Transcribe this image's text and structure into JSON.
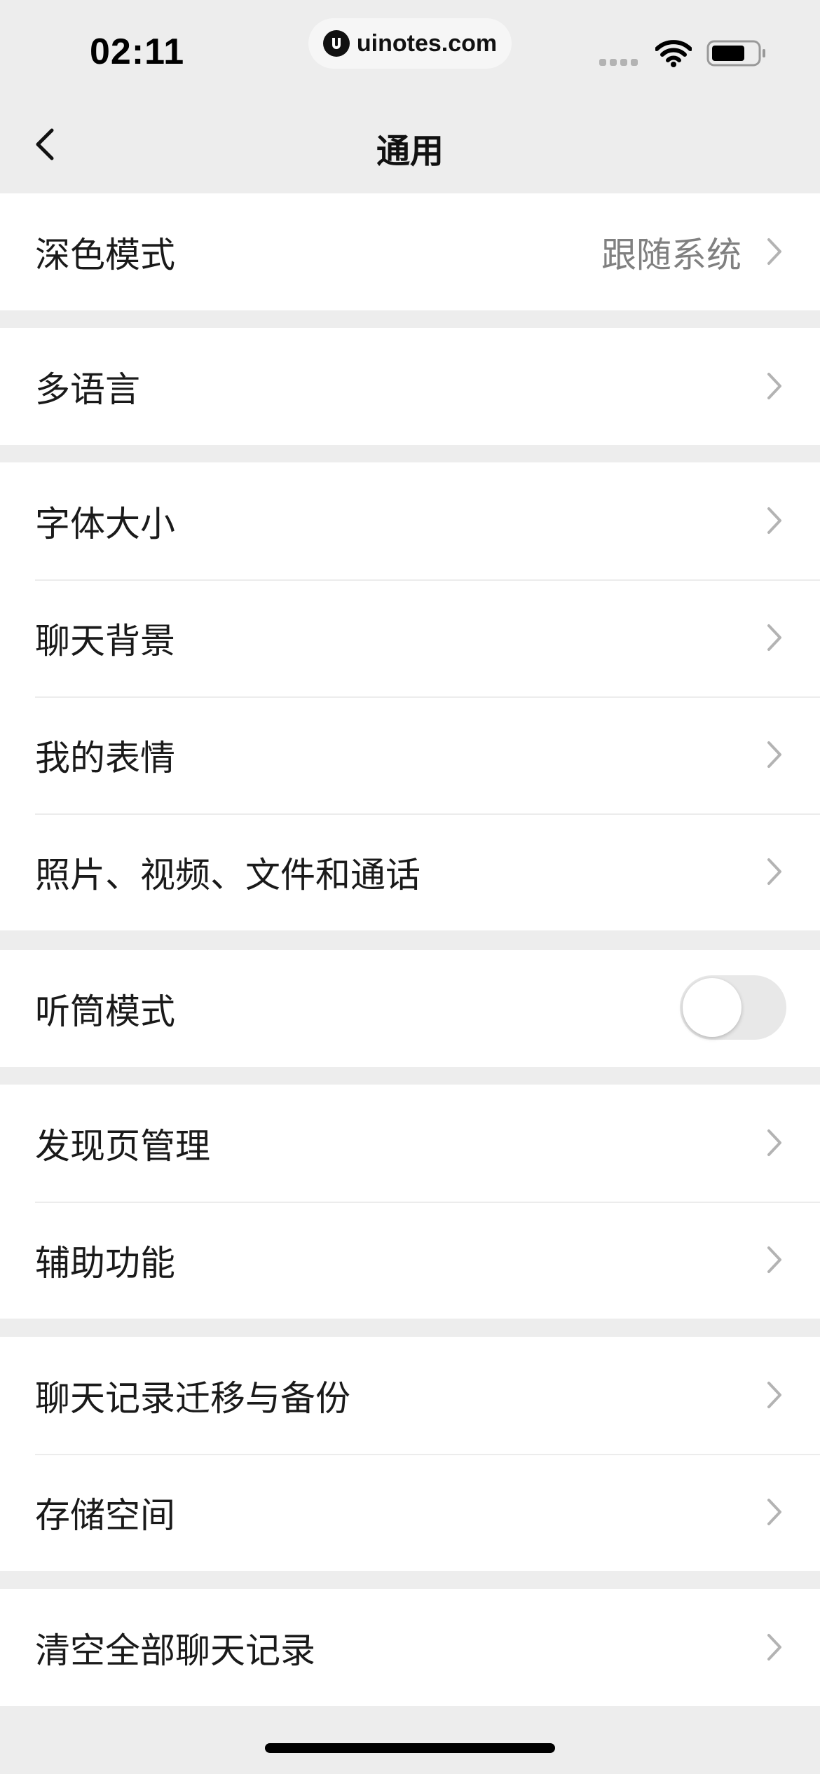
{
  "status_bar": {
    "time": "02:11",
    "url": "uinotes.com",
    "icons": [
      "signal-icon",
      "wifi-icon",
      "battery-icon"
    ]
  },
  "nav": {
    "title": "通用",
    "back_icon": "chevron-left-icon"
  },
  "colors": {
    "background": "#ededed",
    "cell": "#ffffff",
    "secondary_text": "#808080",
    "chevron": "#b3b3b3"
  },
  "groups": [
    {
      "rows": [
        {
          "label": "深色模式",
          "value": "跟随系统"
        }
      ]
    },
    {
      "rows": [
        {
          "label": "多语言"
        }
      ]
    },
    {
      "rows": [
        {
          "label": "字体大小"
        },
        {
          "label": "聊天背景"
        },
        {
          "label": "我的表情"
        },
        {
          "label": "照片、视频、文件和通话"
        }
      ]
    },
    {
      "rows": [
        {
          "label": "听筒模式",
          "toggle_on": false
        }
      ]
    },
    {
      "rows": [
        {
          "label": "发现页管理"
        },
        {
          "label": "辅助功能"
        }
      ]
    },
    {
      "rows": [
        {
          "label": "聊天记录迁移与备份"
        },
        {
          "label": "存储空间"
        }
      ]
    },
    {
      "rows": [
        {
          "label": "清空全部聊天记录"
        }
      ]
    }
  ]
}
